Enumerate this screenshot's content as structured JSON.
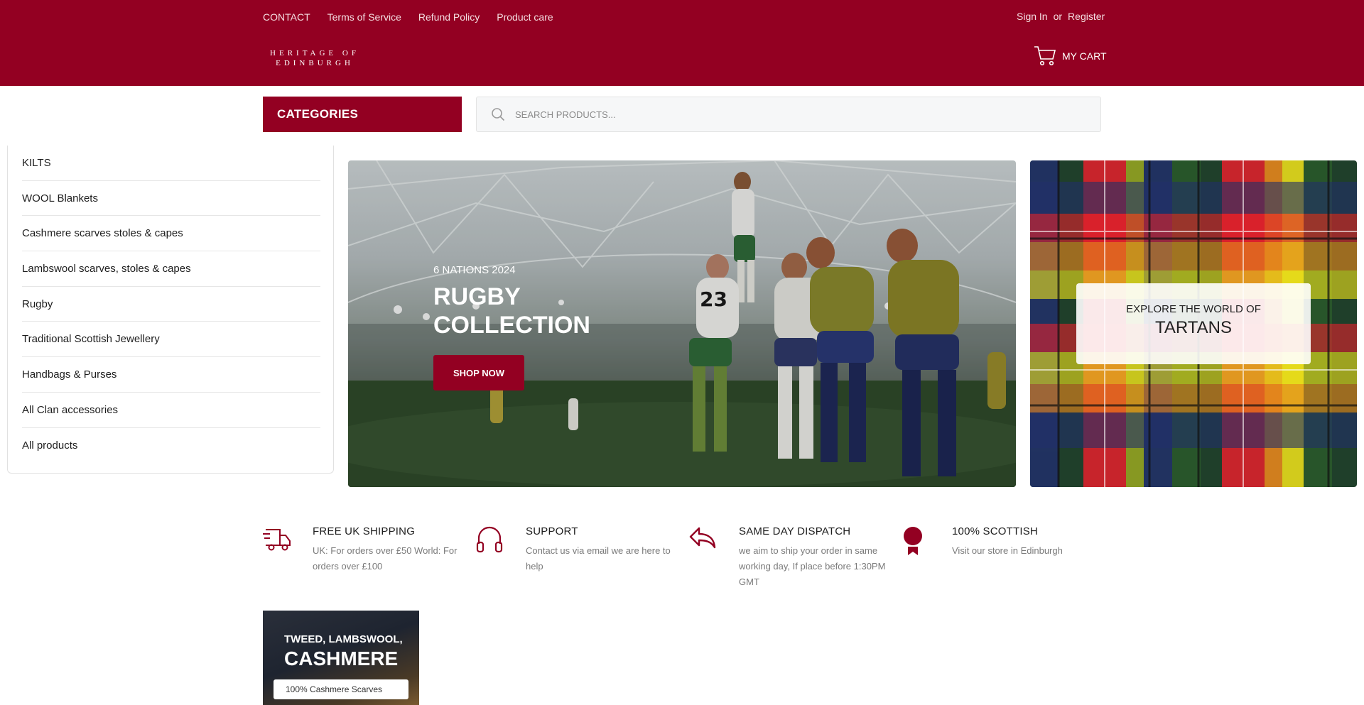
{
  "header": {
    "links": [
      "CONTACT",
      "Terms of Service",
      "Refund Policy",
      "Product care"
    ],
    "sign_in": "Sign In",
    "or": "or",
    "register": "Register",
    "logo_line1": "HERITAGE OF",
    "logo_line2": "EDINBURGH",
    "cart_label": "MY CART"
  },
  "categories": {
    "button_label": "CATEGORIES",
    "items": [
      "KILTS",
      "WOOL Blankets",
      "Cashmere scarves stoles & capes",
      "Lambswool scarves, stoles & capes",
      "Rugby",
      "Traditional Scottish Jewellery",
      "Handbags & Purses",
      "All Clan accessories",
      "All products"
    ]
  },
  "search": {
    "placeholder": "SEARCH PRODUCTS..."
  },
  "hero": {
    "kicker": "6 NATIONS 2024",
    "title_line1": "RUGBY",
    "title_line2": "COLLECTION",
    "button": "SHOP NOW",
    "player_number": "23"
  },
  "tartan_banner": {
    "line1": "EXPLORE THE WORLD OF",
    "line2": "TARTANS"
  },
  "features": [
    {
      "icon": "shipping-truck-icon",
      "title": "FREE UK SHIPPING",
      "text": "UK: For orders over £50 World: For orders over £100"
    },
    {
      "icon": "headphones-icon",
      "title": "SUPPORT",
      "text": "Contact us via email we are here to help"
    },
    {
      "icon": "reply-arrow-icon",
      "title": "SAME DAY DISPATCH",
      "text": "we aim to ship your order in same working day, If place before 1:30PM GMT"
    },
    {
      "icon": "rosette-badge-icon",
      "title": "100% SCOTTISH",
      "text": "Visit our store in Edinburgh"
    }
  ],
  "promo": {
    "line1": "TWEED, LAMBSWOOL,",
    "line2": "CASHMERE",
    "tag": "100% Cashmere Scarves"
  },
  "colors": {
    "brand": "#930022",
    "text": "#1d1d1d",
    "muted": "#7a7a7a"
  }
}
